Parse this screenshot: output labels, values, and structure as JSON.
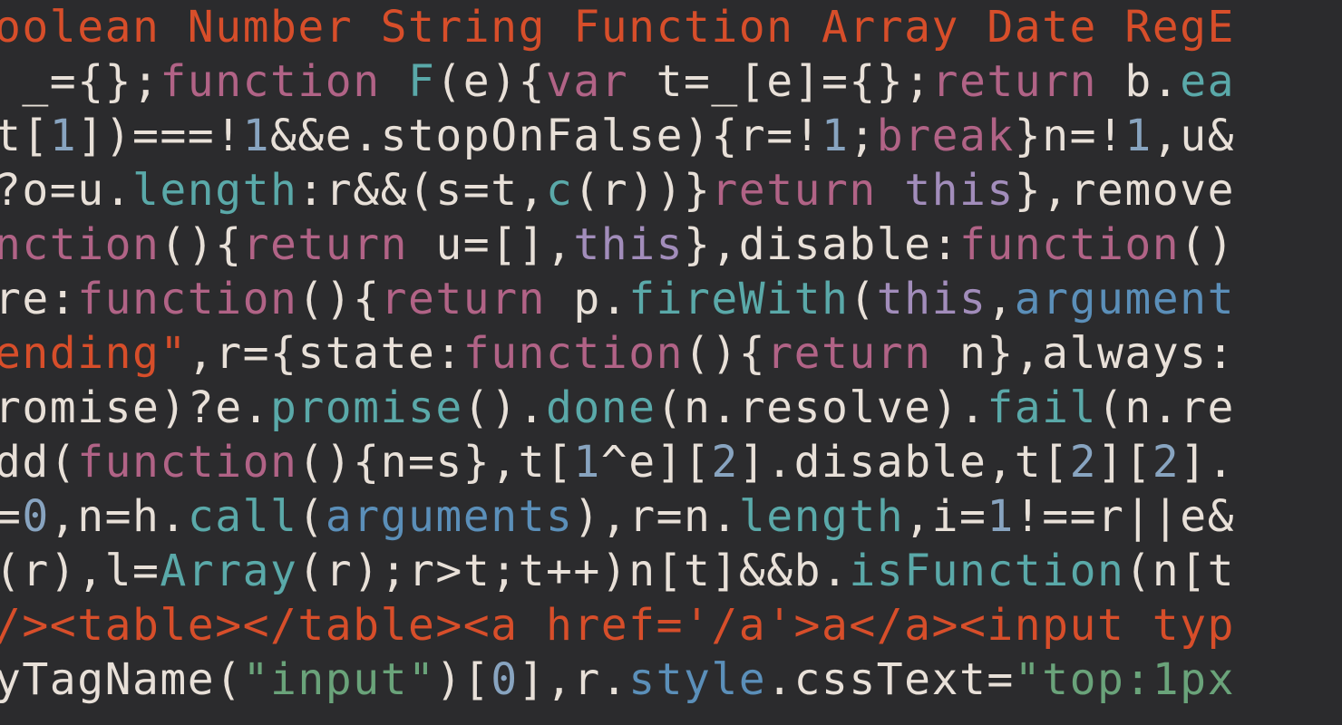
{
  "lines": [
    [
      {
        "t": "oolean Number String Function Array Date RegE",
        "c": "c-orange"
      }
    ],
    [
      {
        "t": " _",
        "c": "c-default"
      },
      {
        "t": "=",
        "c": "c-default"
      },
      {
        "t": "{};",
        "c": "c-default"
      },
      {
        "t": "function",
        "c": "c-pink"
      },
      {
        "t": " ",
        "c": "c-default"
      },
      {
        "t": "F",
        "c": "c-cyan"
      },
      {
        "t": "(e){",
        "c": "c-default"
      },
      {
        "t": "var",
        "c": "c-pink"
      },
      {
        "t": " t",
        "c": "c-default"
      },
      {
        "t": "=",
        "c": "c-default"
      },
      {
        "t": "_[e]",
        "c": "c-default"
      },
      {
        "t": "=",
        "c": "c-default"
      },
      {
        "t": "{};",
        "c": "c-default"
      },
      {
        "t": "return",
        "c": "c-pink"
      },
      {
        "t": " b.",
        "c": "c-default"
      },
      {
        "t": "ea",
        "c": "c-cyan"
      }
    ],
    [
      {
        "t": "t[",
        "c": "c-default"
      },
      {
        "t": "1",
        "c": "c-num"
      },
      {
        "t": "])",
        "c": "c-default"
      },
      {
        "t": "===!",
        "c": "c-default"
      },
      {
        "t": "1",
        "c": "c-num"
      },
      {
        "t": "&&",
        "c": "c-default"
      },
      {
        "t": "e.",
        "c": "c-default"
      },
      {
        "t": "stopOnFalse",
        "c": "c-default"
      },
      {
        "t": "){r",
        "c": "c-default"
      },
      {
        "t": "=!",
        "c": "c-default"
      },
      {
        "t": "1",
        "c": "c-num"
      },
      {
        "t": ";",
        "c": "c-default"
      },
      {
        "t": "break",
        "c": "c-pink"
      },
      {
        "t": "}n",
        "c": "c-default"
      },
      {
        "t": "=!",
        "c": "c-default"
      },
      {
        "t": "1",
        "c": "c-num"
      },
      {
        "t": ",u&",
        "c": "c-default"
      }
    ],
    [
      {
        "t": "?o",
        "c": "c-default"
      },
      {
        "t": "=",
        "c": "c-default"
      },
      {
        "t": "u.",
        "c": "c-default"
      },
      {
        "t": "length",
        "c": "c-cyan"
      },
      {
        "t": ":r",
        "c": "c-default"
      },
      {
        "t": "&&",
        "c": "c-default"
      },
      {
        "t": "(s",
        "c": "c-default"
      },
      {
        "t": "=",
        "c": "c-default"
      },
      {
        "t": "t,",
        "c": "c-default"
      },
      {
        "t": "c",
        "c": "c-cyan"
      },
      {
        "t": "(r))}",
        "c": "c-default"
      },
      {
        "t": "return",
        "c": "c-pink"
      },
      {
        "t": " ",
        "c": "c-default"
      },
      {
        "t": "this",
        "c": "c-lilac"
      },
      {
        "t": "},remove",
        "c": "c-default"
      }
    ],
    [
      {
        "t": "nction",
        "c": "c-pink"
      },
      {
        "t": "(){",
        "c": "c-default"
      },
      {
        "t": "return",
        "c": "c-pink"
      },
      {
        "t": " u",
        "c": "c-default"
      },
      {
        "t": "=",
        "c": "c-default"
      },
      {
        "t": "[],",
        "c": "c-default"
      },
      {
        "t": "this",
        "c": "c-lilac"
      },
      {
        "t": "},disable:",
        "c": "c-default"
      },
      {
        "t": "function",
        "c": "c-pink"
      },
      {
        "t": "()",
        "c": "c-default"
      }
    ],
    [
      {
        "t": "re:",
        "c": "c-default"
      },
      {
        "t": "function",
        "c": "c-pink"
      },
      {
        "t": "(){",
        "c": "c-default"
      },
      {
        "t": "return",
        "c": "c-pink"
      },
      {
        "t": " p.",
        "c": "c-default"
      },
      {
        "t": "fireWith",
        "c": "c-cyan"
      },
      {
        "t": "(",
        "c": "c-default"
      },
      {
        "t": "this",
        "c": "c-lilac"
      },
      {
        "t": ",",
        "c": "c-default"
      },
      {
        "t": "argument",
        "c": "c-blue"
      }
    ],
    [
      {
        "t": "ending\"",
        "c": "c-orange"
      },
      {
        "t": ",r",
        "c": "c-default"
      },
      {
        "t": "=",
        "c": "c-default"
      },
      {
        "t": "{state:",
        "c": "c-default"
      },
      {
        "t": "function",
        "c": "c-pink"
      },
      {
        "t": "(){",
        "c": "c-default"
      },
      {
        "t": "return",
        "c": "c-pink"
      },
      {
        "t": " n},always:",
        "c": "c-default"
      }
    ],
    [
      {
        "t": "romise)?e.",
        "c": "c-default"
      },
      {
        "t": "promise",
        "c": "c-cyan"
      },
      {
        "t": "().",
        "c": "c-default"
      },
      {
        "t": "done",
        "c": "c-cyan"
      },
      {
        "t": "(n.resolve).",
        "c": "c-default"
      },
      {
        "t": "fail",
        "c": "c-cyan"
      },
      {
        "t": "(n.re",
        "c": "c-default"
      }
    ],
    [
      {
        "t": "dd(",
        "c": "c-default"
      },
      {
        "t": "function",
        "c": "c-pink"
      },
      {
        "t": "(){n",
        "c": "c-default"
      },
      {
        "t": "=",
        "c": "c-default"
      },
      {
        "t": "s},t[",
        "c": "c-default"
      },
      {
        "t": "1",
        "c": "c-num"
      },
      {
        "t": "^",
        "c": "c-default"
      },
      {
        "t": "e][",
        "c": "c-default"
      },
      {
        "t": "2",
        "c": "c-num"
      },
      {
        "t": "].disable,t[",
        "c": "c-default"
      },
      {
        "t": "2",
        "c": "c-num"
      },
      {
        "t": "][",
        "c": "c-default"
      },
      {
        "t": "2",
        "c": "c-num"
      },
      {
        "t": "].",
        "c": "c-default"
      }
    ],
    [
      {
        "t": "=",
        "c": "c-default"
      },
      {
        "t": "0",
        "c": "c-num"
      },
      {
        "t": ",n",
        "c": "c-default"
      },
      {
        "t": "=",
        "c": "c-default"
      },
      {
        "t": "h.",
        "c": "c-default"
      },
      {
        "t": "call",
        "c": "c-cyan"
      },
      {
        "t": "(",
        "c": "c-default"
      },
      {
        "t": "arguments",
        "c": "c-blue"
      },
      {
        "t": "),r",
        "c": "c-default"
      },
      {
        "t": "=",
        "c": "c-default"
      },
      {
        "t": "n.",
        "c": "c-default"
      },
      {
        "t": "length",
        "c": "c-cyan"
      },
      {
        "t": ",i",
        "c": "c-default"
      },
      {
        "t": "=",
        "c": "c-default"
      },
      {
        "t": "1",
        "c": "c-num"
      },
      {
        "t": "!==",
        "c": "c-default"
      },
      {
        "t": "r",
        "c": "c-default"
      },
      {
        "t": "||",
        "c": "c-default"
      },
      {
        "t": "e&",
        "c": "c-default"
      }
    ],
    [
      {
        "t": "(r),l",
        "c": "c-default"
      },
      {
        "t": "=",
        "c": "c-default"
      },
      {
        "t": "Array",
        "c": "c-cyan"
      },
      {
        "t": "(r);r",
        "c": "c-default"
      },
      {
        "t": ">",
        "c": "c-default"
      },
      {
        "t": "t;t",
        "c": "c-default"
      },
      {
        "t": "++",
        "c": "c-default"
      },
      {
        "t": ")n[t]",
        "c": "c-default"
      },
      {
        "t": "&&",
        "c": "c-default"
      },
      {
        "t": "b.",
        "c": "c-default"
      },
      {
        "t": "isFunction",
        "c": "c-cyan"
      },
      {
        "t": "(n[t",
        "c": "c-default"
      }
    ],
    [
      {
        "t": "/><table></table><a href='/a'>a</a><input typ",
        "c": "c-orange"
      }
    ],
    [
      {
        "t": "yTagName(",
        "c": "c-default"
      },
      {
        "t": "\"input\"",
        "c": "c-green"
      },
      {
        "t": ")[",
        "c": "c-default"
      },
      {
        "t": "0",
        "c": "c-num"
      },
      {
        "t": "],r.",
        "c": "c-default"
      },
      {
        "t": "style",
        "c": "c-blue"
      },
      {
        "t": ".cssText",
        "c": "c-default"
      },
      {
        "t": "=",
        "c": "c-default"
      },
      {
        "t": "\"top:1px",
        "c": "c-green"
      }
    ]
  ]
}
